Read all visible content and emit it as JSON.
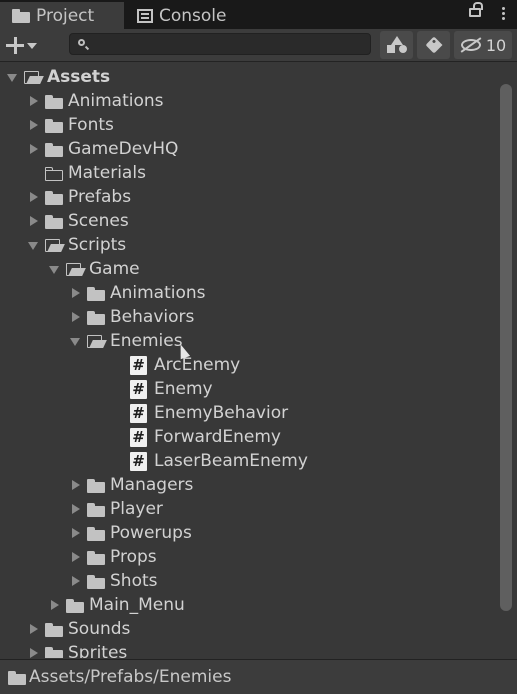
{
  "tabs": [
    {
      "label": "Project",
      "icon": "folder-icon",
      "active": true
    },
    {
      "label": "Console",
      "icon": "console-icon",
      "active": false
    }
  ],
  "toolbar": {
    "search_placeholder": "",
    "hidden_count": "10"
  },
  "tree": [
    {
      "label": "Assets",
      "depth": 0,
      "arrow": "down",
      "icon": "folder-open",
      "bold": true
    },
    {
      "label": "Animations",
      "depth": 1,
      "arrow": "right",
      "icon": "folder-closed"
    },
    {
      "label": "Fonts",
      "depth": 1,
      "arrow": "right",
      "icon": "folder-closed"
    },
    {
      "label": "GameDevHQ",
      "depth": 1,
      "arrow": "right",
      "icon": "folder-closed"
    },
    {
      "label": "Materials",
      "depth": 1,
      "arrow": "none",
      "icon": "folder-empty"
    },
    {
      "label": "Prefabs",
      "depth": 1,
      "arrow": "right",
      "icon": "folder-closed"
    },
    {
      "label": "Scenes",
      "depth": 1,
      "arrow": "right",
      "icon": "folder-closed"
    },
    {
      "label": "Scripts",
      "depth": 1,
      "arrow": "down",
      "icon": "folder-open"
    },
    {
      "label": "Game",
      "depth": 2,
      "arrow": "down",
      "icon": "folder-open"
    },
    {
      "label": "Animations",
      "depth": 3,
      "arrow": "right",
      "icon": "folder-closed"
    },
    {
      "label": "Behaviors",
      "depth": 3,
      "arrow": "right",
      "icon": "folder-closed"
    },
    {
      "label": "Enemies",
      "depth": 3,
      "arrow": "down",
      "icon": "folder-open"
    },
    {
      "label": "ArcEnemy",
      "depth": 4,
      "arrow": "none",
      "icon": "script"
    },
    {
      "label": "Enemy",
      "depth": 4,
      "arrow": "none",
      "icon": "script"
    },
    {
      "label": "EnemyBehavior",
      "depth": 4,
      "arrow": "none",
      "icon": "script"
    },
    {
      "label": "ForwardEnemy",
      "depth": 4,
      "arrow": "none",
      "icon": "script"
    },
    {
      "label": "LaserBeamEnemy",
      "depth": 4,
      "arrow": "none",
      "icon": "script"
    },
    {
      "label": "Managers",
      "depth": 3,
      "arrow": "right",
      "icon": "folder-closed"
    },
    {
      "label": "Player",
      "depth": 3,
      "arrow": "right",
      "icon": "folder-closed"
    },
    {
      "label": "Powerups",
      "depth": 3,
      "arrow": "right",
      "icon": "folder-closed"
    },
    {
      "label": "Props",
      "depth": 3,
      "arrow": "right",
      "icon": "folder-closed"
    },
    {
      "label": "Shots",
      "depth": 3,
      "arrow": "right",
      "icon": "folder-closed"
    },
    {
      "label": "Main_Menu",
      "depth": 2,
      "arrow": "right",
      "icon": "folder-closed"
    },
    {
      "label": "Sounds",
      "depth": 1,
      "arrow": "right",
      "icon": "folder-closed"
    },
    {
      "label": "Sprites",
      "depth": 1,
      "arrow": "right",
      "icon": "folder-closed"
    }
  ],
  "status": {
    "path": "Assets/Prefabs/Enemies"
  },
  "colors": {
    "background": "#383838",
    "tabbar": "#191919",
    "text": "#d2d2d2"
  }
}
